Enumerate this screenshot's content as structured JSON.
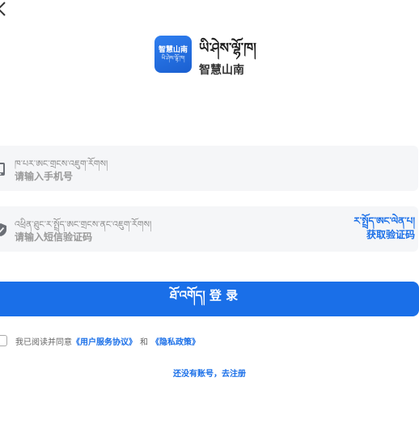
{
  "header": {
    "back_icon": "chevron-left-icon"
  },
  "app": {
    "logo_line1": "智慧山南",
    "logo_line2": "ཡི་ཤེས་ལྷོ་ཁ།",
    "name_tibetan": "ཡི་ཤེས་ལྷོ་ཁ།",
    "name_chinese": "智慧山南"
  },
  "phone": {
    "icon": "phone-icon",
    "label_tibetan": "ཁ་པར་ཨང་གྲངས་འཇུག་རོགས།",
    "placeholder": "请输入手机号"
  },
  "code": {
    "icon": "shield-check-icon",
    "label_tibetan": "འཕྲིན་ཐུང་ར་སྤྲོད་ཨང་གྲངས་ནང་འཇུག་རོགས།",
    "placeholder": "请输入短信验证码",
    "get_code_tibetan": "ར་སྤྲོད་ཨང་ལེན་པ།",
    "get_code_chinese": "获取验证码"
  },
  "login": {
    "label": "ཐོ་འགོད། 登 录"
  },
  "agreement": {
    "prefix": "我已阅读并同意",
    "user_agreement": "《用户服务协议》",
    "and": "和",
    "privacy_policy": "《隐私政策》"
  },
  "register": {
    "label": "还没有账号，去注册"
  },
  "colors": {
    "accent": "#1a6fe8",
    "field_bg": "#f5f6f8"
  }
}
